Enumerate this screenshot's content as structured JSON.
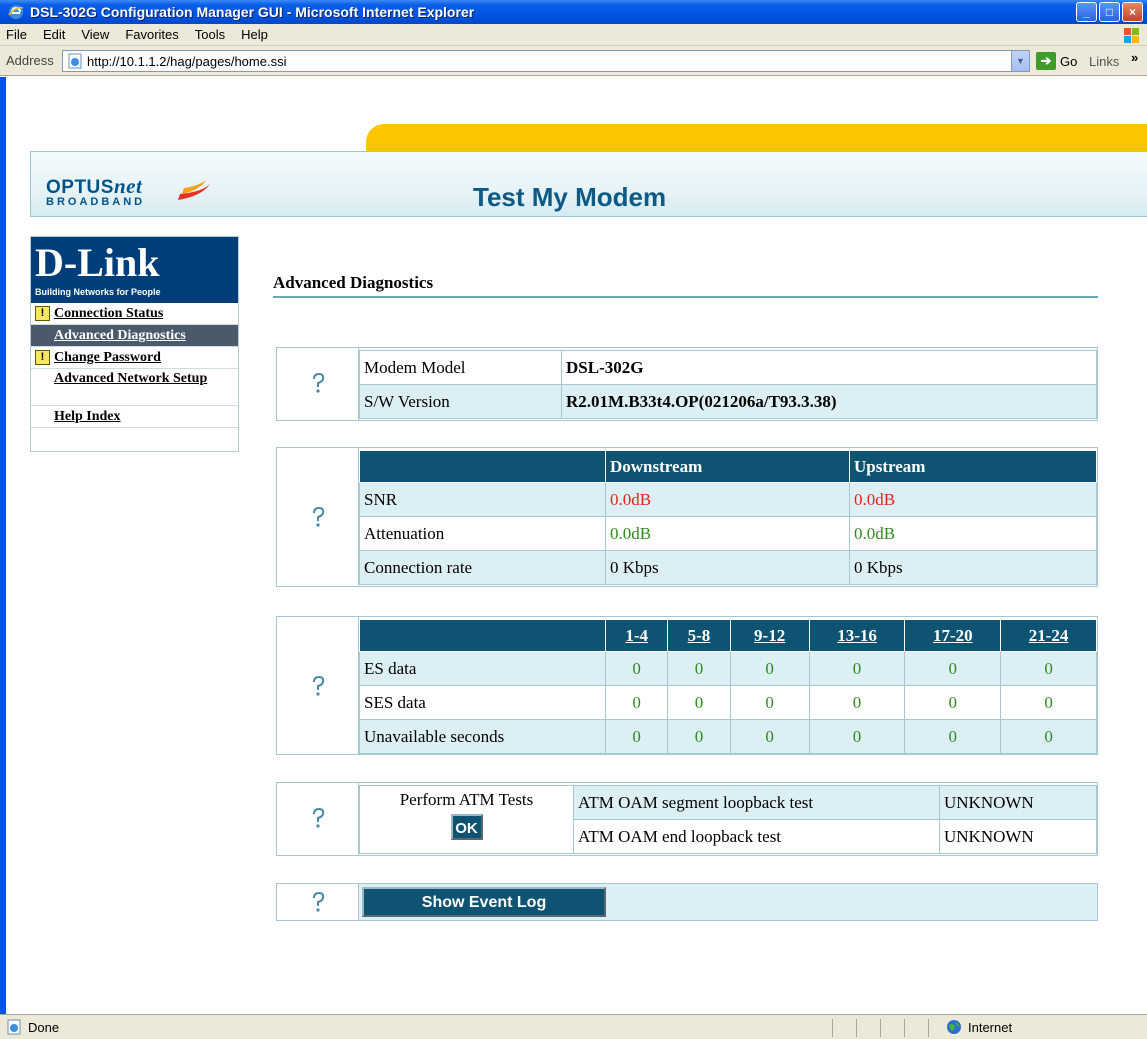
{
  "window": {
    "title": "DSL-302G Configuration Manager GUI - Microsoft Internet Explorer"
  },
  "menu": [
    {
      "label": "File",
      "key": "F"
    },
    {
      "label": "Edit",
      "key": "E"
    },
    {
      "label": "View",
      "key": "V"
    },
    {
      "label": "Favorites",
      "key": "a"
    },
    {
      "label": "Tools",
      "key": "T"
    },
    {
      "label": "Help",
      "key": "H"
    }
  ],
  "addressbar": {
    "label": "Address",
    "url": "http://10.1.1.2/hag/pages/home.ssi",
    "go_label": "Go",
    "links_label": "Links",
    "links_chevron": "»"
  },
  "header": {
    "brand_word": "OPTUS",
    "brand_net": "net",
    "brand_sub": "BROADBAND",
    "title": "Test My Modem"
  },
  "sidebar": {
    "logo_word": "D-Link",
    "logo_tagline": "Building Networks for People",
    "items": [
      {
        "label": "Connection Status",
        "warning": true
      },
      {
        "label": "Advanced Diagnostics",
        "active": true
      },
      {
        "label": "Change Password",
        "warning": true
      },
      {
        "label": "Advanced Network Setup"
      },
      {
        "label": "Help Index"
      }
    ]
  },
  "main": {
    "heading": "Advanced Diagnostics",
    "modem": {
      "model_label": "Modem Model",
      "model_value": "DSL-302G",
      "sw_label": "S/W Version",
      "sw_value": "R2.01M.B33t4.OP(021206a/T93.3.38)"
    },
    "line_stats": {
      "headers": [
        "",
        "Downstream",
        "Upstream"
      ],
      "rows": [
        {
          "label": "SNR",
          "down": "0.0dB",
          "up": "0.0dB"
        },
        {
          "label": "Attenuation",
          "down": "0.0dB",
          "up": "0.0dB"
        },
        {
          "label": "Connection rate",
          "down": "0 Kbps",
          "up": "0 Kbps"
        }
      ]
    },
    "errors": {
      "columns": [
        "1-4",
        "5-8",
        "9-12",
        "13-16",
        "17-20",
        "21-24"
      ],
      "rows": [
        {
          "label": "ES data",
          "values": [
            "0",
            "0",
            "0",
            "0",
            "0",
            "0"
          ]
        },
        {
          "label": "SES data",
          "values": [
            "0",
            "0",
            "0",
            "0",
            "0",
            "0"
          ]
        },
        {
          "label": "Unavailable seconds",
          "values": [
            "0",
            "0",
            "0",
            "0",
            "0",
            "0"
          ]
        }
      ]
    },
    "atm": {
      "perform_label": "Perform ATM Tests",
      "ok_label": "OK",
      "tests": [
        {
          "label": "ATM OAM segment loopback test",
          "result": "UNKNOWN"
        },
        {
          "label": "ATM OAM end loopback test",
          "result": "UNKNOWN"
        }
      ]
    },
    "event_log_label": "Show Event Log",
    "help_glyph": "?"
  },
  "statusbar": {
    "status": "Done",
    "zone": "Internet"
  },
  "colors": {
    "accent": "#0e5472",
    "alt_row": "#dbeff4",
    "snr_value": "#e3231b",
    "ok_value": "#2e8b1e",
    "gold": "#fbc500"
  }
}
